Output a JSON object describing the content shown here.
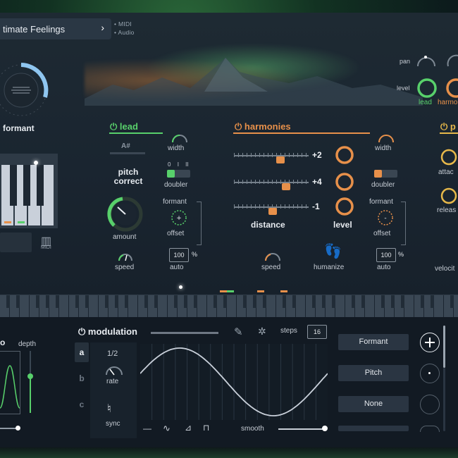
{
  "header": {
    "preset_name": "timate Feelings",
    "chevron": "chevron-right-icon",
    "io_labels": [
      "MIDI",
      "Audio"
    ]
  },
  "left": {
    "formant_label": "formant",
    "keyboard_icon": "midi-keyboard-icon",
    "midi_label": "MIDI"
  },
  "right_top": {
    "pan_label": "pan",
    "level_label": "level",
    "lead_label": "lead",
    "harmonies_label": "harmo"
  },
  "lead": {
    "title": "lead",
    "note": "A#",
    "pitch_correct": "pitch correct",
    "pitch_correct_l1": "pitch",
    "pitch_correct_l2": "correct",
    "amount": "amount",
    "speed": "speed",
    "width": "width",
    "doubler_options": [
      "0",
      "I",
      "II"
    ],
    "doubler": "doubler",
    "formant": "formant",
    "offset": "offset",
    "auto_value": "100",
    "pct": "%",
    "auto": "auto"
  },
  "harmonies": {
    "title": "harmonies",
    "voices": [
      {
        "value": "+2",
        "position": 0.62
      },
      {
        "value": "+4",
        "position": 0.7
      },
      {
        "value": "-1",
        "position": 0.52
      }
    ],
    "distance": "distance",
    "level": "level",
    "width": "width",
    "doubler": "doubler",
    "formant": "formant",
    "offset": "offset",
    "auto_value": "100",
    "pct": "%",
    "auto": "auto",
    "speed": "speed",
    "humanize": "humanize"
  },
  "third": {
    "title": "p",
    "attack": "attac",
    "release": "releas",
    "velocity": "velocit"
  },
  "lfo": {
    "title": "o",
    "depth": "depth"
  },
  "modulation": {
    "title": "modulation",
    "steps_label": "steps",
    "steps_value": "16",
    "tabs": [
      "a",
      "b",
      "c"
    ],
    "rate_value": "1/2",
    "rate": "rate",
    "sync": "sync",
    "smooth": "smooth",
    "shape_icons": [
      "flat-shape-icon",
      "sine-shape-icon",
      "ramp-shape-icon",
      "square-shape-icon"
    ],
    "destinations": [
      "Formant",
      "Pitch",
      "None"
    ]
  },
  "colors": {
    "green": "#58d06b",
    "orange": "#e7904a",
    "blue": "#8fc6f0"
  }
}
